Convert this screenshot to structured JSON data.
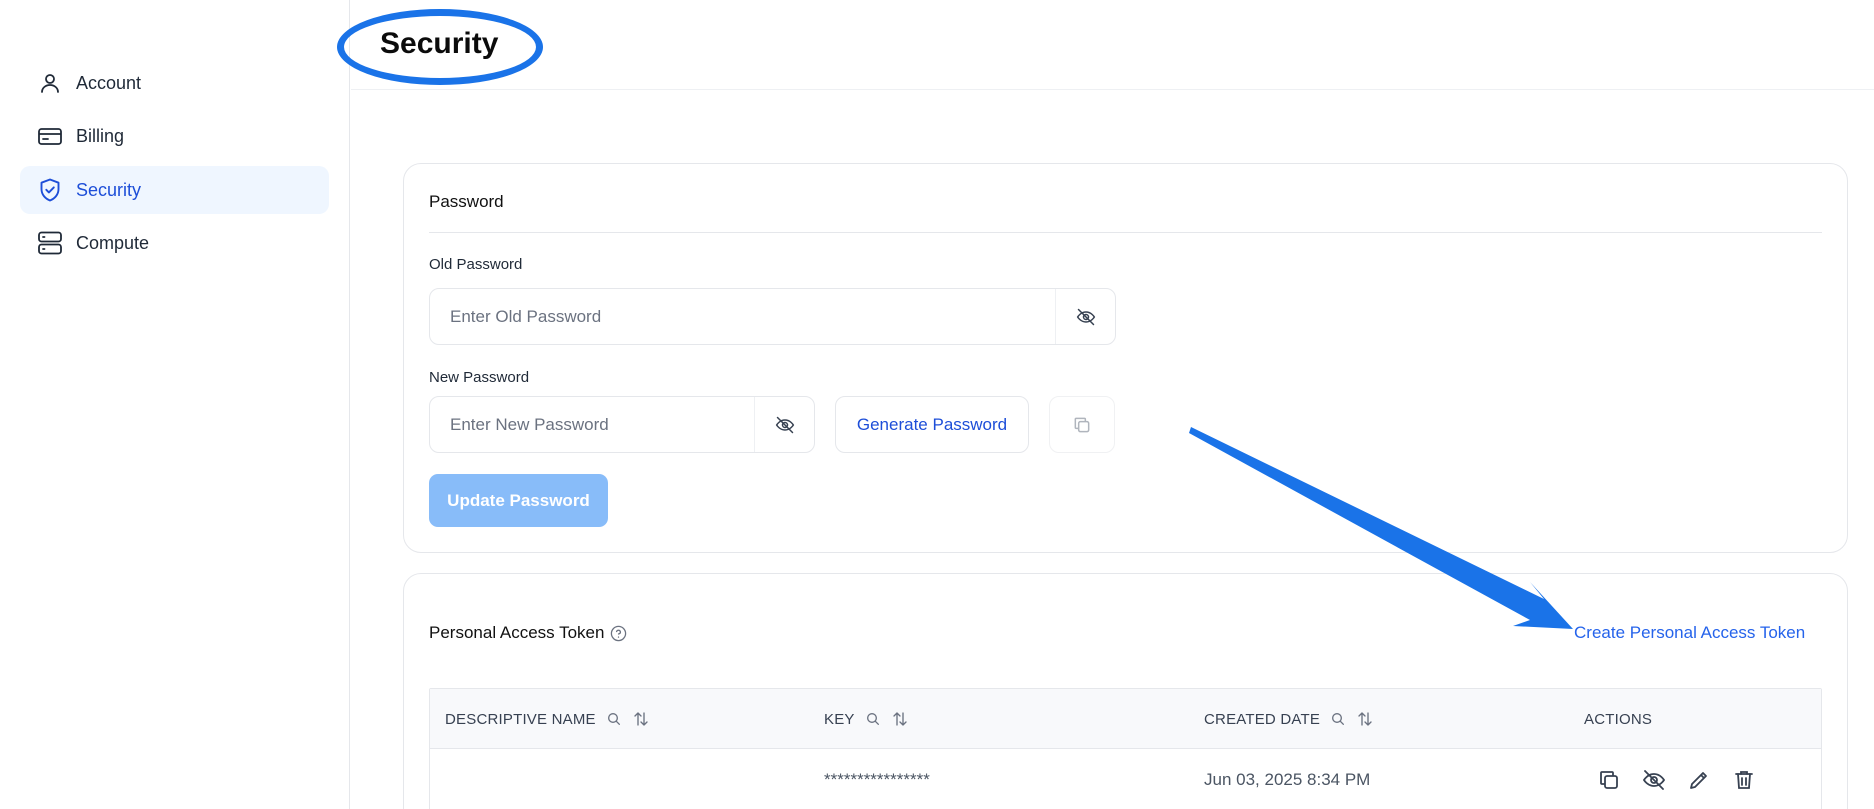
{
  "sidebar": {
    "items": [
      {
        "label": "Account",
        "icon": "user-icon"
      },
      {
        "label": "Billing",
        "icon": "credit-card-icon"
      },
      {
        "label": "Security",
        "icon": "shield-check-icon",
        "active": true
      },
      {
        "label": "Compute",
        "icon": "server-icon"
      }
    ]
  },
  "header": {
    "title": "Security"
  },
  "password": {
    "section_title": "Password",
    "old_label": "Old Password",
    "old_placeholder": "Enter Old Password",
    "new_label": "New Password",
    "new_placeholder": "Enter New Password",
    "generate_label": "Generate Password",
    "update_label": "Update Password"
  },
  "token": {
    "section_title": "Personal Access Token",
    "create_label": "Create Personal Access Token",
    "columns": [
      "DESCRIPTIVE NAME",
      "KEY",
      "CREATED DATE",
      "ACTIONS"
    ],
    "rows": [
      {
        "name": "",
        "key": "****************",
        "created": "Jun 03, 2025 8:34 PM"
      }
    ]
  },
  "colors": {
    "accent": "#1d4ed8",
    "annotation": "#1a73e8",
    "update_button": "#88bcf9",
    "active_nav_bg": "#eff6ff"
  }
}
